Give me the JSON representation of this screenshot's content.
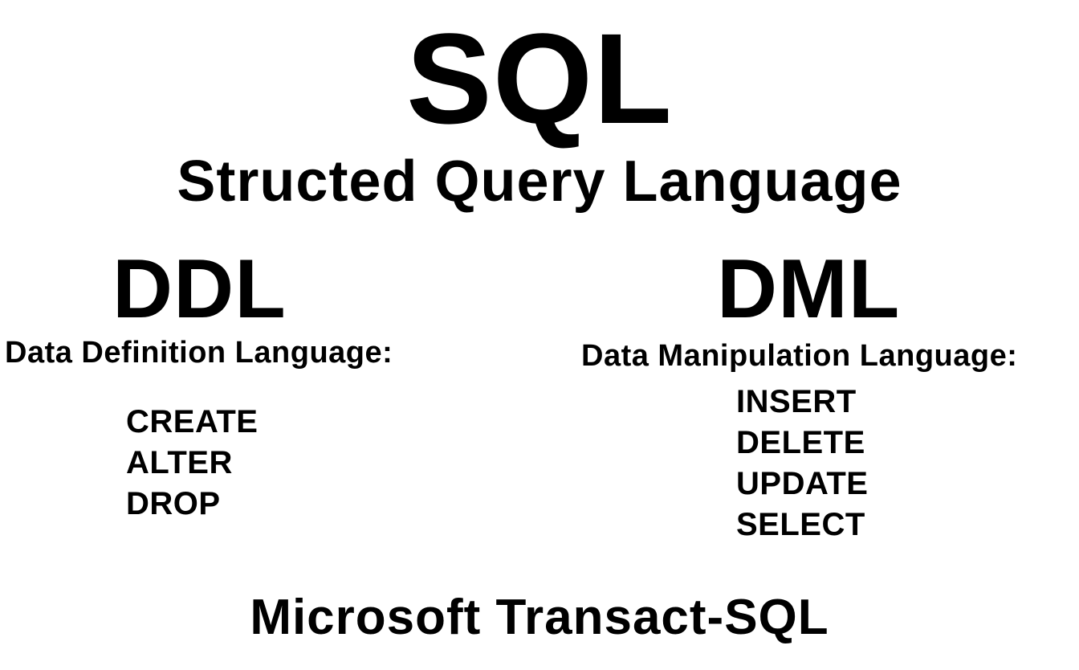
{
  "title": "SQL",
  "subtitle": "Structed Query Language",
  "ddl": {
    "heading": "DDL",
    "subheading": "Data Definition Language:",
    "commands": [
      "CREATE",
      "ALTER",
      "DROP"
    ]
  },
  "dml": {
    "heading": "DML",
    "subheading": "Data Manipulation Language:",
    "commands": [
      "INSERT",
      "DELETE",
      "UPDATE",
      "SELECT"
    ]
  },
  "footer": "Microsoft Transact-SQL",
  "colors": {
    "background": "#ffffff",
    "text": "#000000"
  }
}
